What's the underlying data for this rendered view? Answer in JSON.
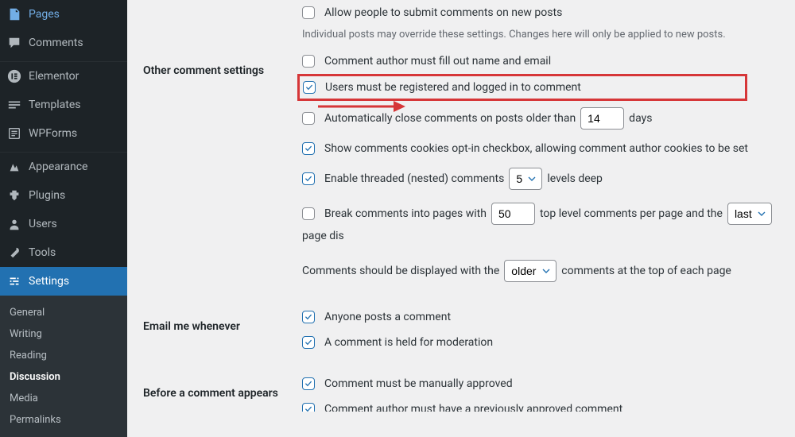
{
  "sidebar": {
    "items": [
      {
        "label": "Pages"
      },
      {
        "label": "Comments"
      },
      {
        "label": "Elementor"
      },
      {
        "label": "Templates"
      },
      {
        "label": "WPForms"
      },
      {
        "label": "Appearance"
      },
      {
        "label": "Plugins"
      },
      {
        "label": "Users"
      },
      {
        "label": "Tools"
      },
      {
        "label": "Settings"
      }
    ],
    "submenu": [
      {
        "label": "General"
      },
      {
        "label": "Writing"
      },
      {
        "label": "Reading"
      },
      {
        "label": "Discussion"
      },
      {
        "label": "Media"
      },
      {
        "label": "Permalinks"
      }
    ]
  },
  "main": {
    "top_check_label": "Allow people to submit comments on new posts",
    "top_desc": "Individual posts may override these settings. Changes here will only be applied to new posts.",
    "sections": {
      "other": {
        "title": "Other comment settings",
        "name_email": "Comment author must fill out name and email",
        "registered": "Users must be registered and logged in to comment",
        "auto_close_pre": "Automatically close comments on posts older than",
        "auto_close_days": "14",
        "auto_close_post": "days",
        "cookies": "Show comments cookies opt-in checkbox, allowing comment author cookies to be set",
        "threaded_pre": "Enable threaded (nested) comments",
        "threaded_val": "5",
        "threaded_post": "levels deep",
        "break_pre": "Break comments into pages with",
        "break_val": "50",
        "break_mid": "top level comments per page and the",
        "break_sel": "last",
        "break_post": "page dis",
        "order_pre": "Comments should be displayed with the",
        "order_val": "older",
        "order_post": "comments at the top of each page"
      },
      "email": {
        "title": "Email me whenever",
        "anyone": "Anyone posts a comment",
        "held": "A comment is held for moderation"
      },
      "before": {
        "title": "Before a comment appears",
        "manual": "Comment must be manually approved",
        "prev": "Comment author must have a previously approved comment"
      }
    }
  }
}
